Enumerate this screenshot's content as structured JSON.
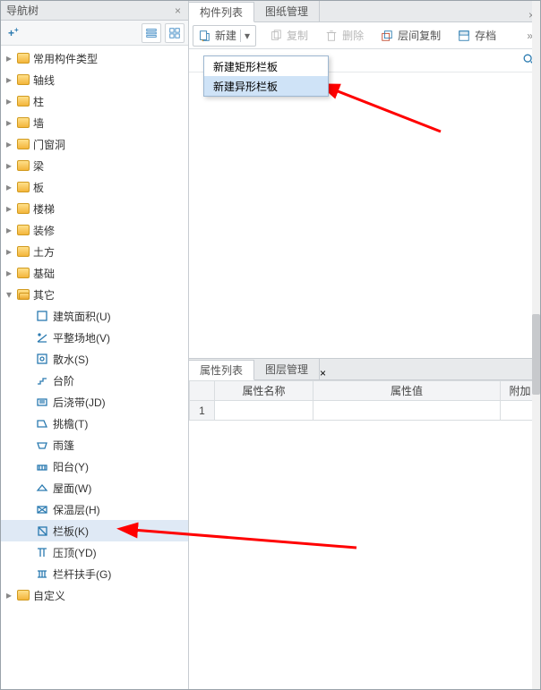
{
  "nav": {
    "title": "导航树",
    "add_label": "+",
    "categories": [
      {
        "label": "常用构件类型"
      },
      {
        "label": "轴线"
      },
      {
        "label": "柱"
      },
      {
        "label": "墙"
      },
      {
        "label": "门窗洞"
      },
      {
        "label": "梁"
      },
      {
        "label": "板"
      },
      {
        "label": "楼梯"
      },
      {
        "label": "装修"
      },
      {
        "label": "土方"
      },
      {
        "label": "基础"
      },
      {
        "label": "其它",
        "open": true
      },
      {
        "label": "自定义"
      }
    ],
    "other_children": [
      {
        "icon": "area",
        "label": "建筑面积(U)"
      },
      {
        "icon": "level",
        "label": "平整场地(V)"
      },
      {
        "icon": "scatter",
        "label": "散水(S)"
      },
      {
        "icon": "step",
        "label": "台阶"
      },
      {
        "icon": "pour",
        "label": "后浇带(JD)"
      },
      {
        "icon": "cant",
        "label": "挑檐(T)"
      },
      {
        "icon": "canopy",
        "label": "雨篷"
      },
      {
        "icon": "balcony",
        "label": "阳台(Y)"
      },
      {
        "icon": "roof",
        "label": "屋面(W)"
      },
      {
        "icon": "insul",
        "label": "保温层(H)"
      },
      {
        "icon": "rail",
        "label": "栏板(K)",
        "selected": true
      },
      {
        "icon": "cap",
        "label": "压顶(YD)"
      },
      {
        "icon": "handrail",
        "label": "栏杆扶手(G)"
      }
    ]
  },
  "component_list": {
    "tabs": [
      "构件列表",
      "图纸管理"
    ],
    "active_tab": 0,
    "toolbar": {
      "new_label": "新建",
      "copy_label": "复制",
      "delete_label": "删除",
      "layer_copy_label": "层间复制",
      "archive_label": "存档"
    },
    "dropdown_items": [
      {
        "label": "新建矩形栏板"
      },
      {
        "label": "新建异形栏板",
        "hover": true
      }
    ],
    "search_placeholder": ""
  },
  "property_panel": {
    "tabs": [
      "属性列表",
      "图层管理"
    ],
    "active_tab": 0,
    "columns": [
      "属性名称",
      "属性值",
      "附加"
    ],
    "rows": [
      {
        "num": "1",
        "name": "",
        "value": "",
        "extra": ""
      }
    ]
  }
}
